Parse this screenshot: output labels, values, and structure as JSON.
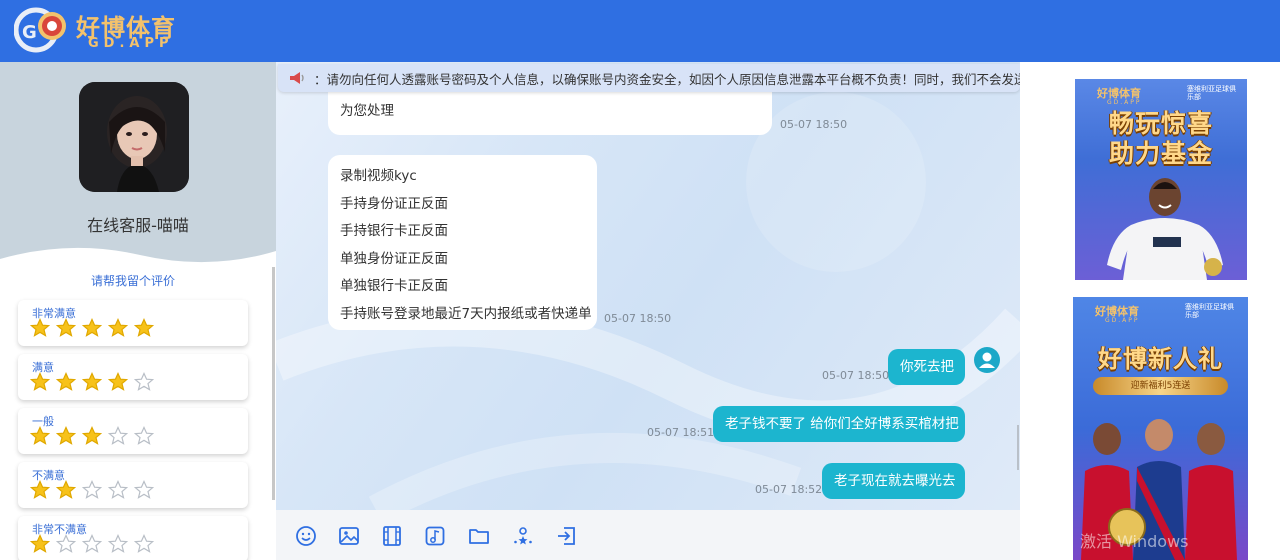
{
  "header": {
    "logo_cn": "好博体育",
    "logo_en": "GD.APP"
  },
  "sidebar": {
    "agent_name": "在线客服-喵喵",
    "rating_prompt": "请帮我留个评价",
    "ratings": [
      {
        "label": "非常满意",
        "stars": 5
      },
      {
        "label": "满意",
        "stars": 4
      },
      {
        "label": "一般",
        "stars": 3
      },
      {
        "label": "不满意",
        "stars": 2
      },
      {
        "label": "非常不满意",
        "stars": 1
      }
    ],
    "max_stars": 5
  },
  "notice": {
    "text": "：请勿向任何人透露账号密码及个人信息，以确保账号内资金安全，如因个人原因信息泄露本平台概不负责！同时，我们不会发送确认"
  },
  "messages": [
    {
      "side": "agent",
      "lines": [
        "为您处理"
      ],
      "time": "05-07 18:50"
    },
    {
      "side": "agent",
      "lines": [
        "录制视频kyc",
        "手持身份证正反面",
        "手持银行卡正反面",
        "单独身份证正反面",
        "单独银行卡正反面",
        "手持账号登录地最近7天内报纸或者快递单"
      ],
      "time": "05-07 18:50"
    },
    {
      "side": "user",
      "text": "你死去把",
      "time": "05-07 18:50"
    },
    {
      "side": "user",
      "text": "老子钱不要了 给你们全好博系买棺材把",
      "time": "05-07 18:51"
    },
    {
      "side": "user",
      "text": "老子现在就去曝光去",
      "time": "05-07 18:52"
    }
  ],
  "toolbar": {
    "tools": [
      "emoji-icon",
      "image-icon",
      "video-icon",
      "music-icon",
      "folder-icon",
      "rate-icon",
      "exit-icon"
    ]
  },
  "banners": [
    {
      "logo_cn": "好博体育",
      "logo_en": "GD.APP",
      "club": "塞维利亚足球俱乐部",
      "title": "畅玩惊喜 助力基金"
    },
    {
      "logo_cn": "好博体育",
      "logo_en": "GD.APP",
      "club": "塞维利亚足球俱乐部",
      "title": "好博新人礼",
      "subtitle": "迎新福利5连送"
    }
  ],
  "watermark": "激活 Windows",
  "colors": {
    "header": "#2f6fe2",
    "user_bubble": "#1cb5cf",
    "accent": "#3a6fd6",
    "star": "#f7c21a"
  }
}
